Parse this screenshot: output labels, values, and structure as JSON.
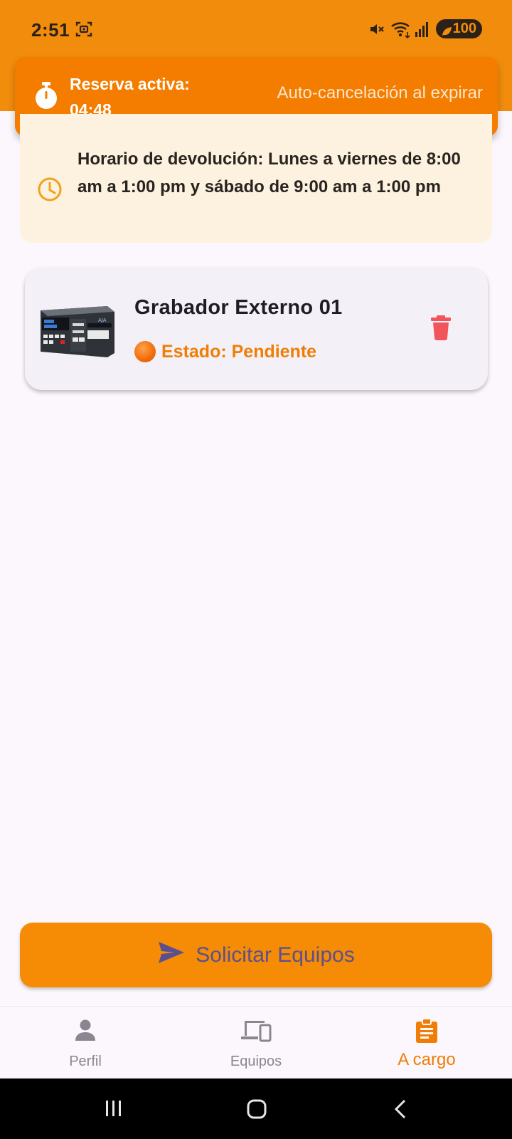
{
  "status_bar": {
    "time": "2:51",
    "battery": "100",
    "icons": [
      "screenshot-icon",
      "mute-icon",
      "wifi-icon",
      "signal-icon",
      "battery-icon"
    ]
  },
  "reserve_banner": {
    "title": "Reserva activa:",
    "time_left": "04:48",
    "note": "Auto-cancelación al expirar",
    "icon": "timer-icon"
  },
  "info_box": {
    "text": "Horario de devolución: Lunes a viernes de 8:00 am a 1:00 pm y sábado de 9:00 am a 1:00 pm",
    "icon": "clock-icon"
  },
  "items": [
    {
      "title": "Grabador Externo 01",
      "status": "Estado: Pendiente",
      "thumbnail": "recorder-thumbnail",
      "delete_icon": "trash-icon"
    }
  ],
  "request_button": {
    "label": "Solicitar Equipos",
    "icon": "send-icon"
  },
  "bottom_nav": {
    "items": [
      {
        "label": "Perfil",
        "icon": "person-icon",
        "active": false
      },
      {
        "label": "Equipos",
        "icon": "devices-icon",
        "active": false
      },
      {
        "label": "A cargo",
        "icon": "clipboard-icon",
        "active": true
      }
    ]
  },
  "colors": {
    "primary": "#f28c0c",
    "banner": "#f47d00",
    "status_pending": "#ef7d06",
    "delete": "#f2545b",
    "button_text": "#5a5090",
    "info_bg": "#fdf2e0"
  }
}
